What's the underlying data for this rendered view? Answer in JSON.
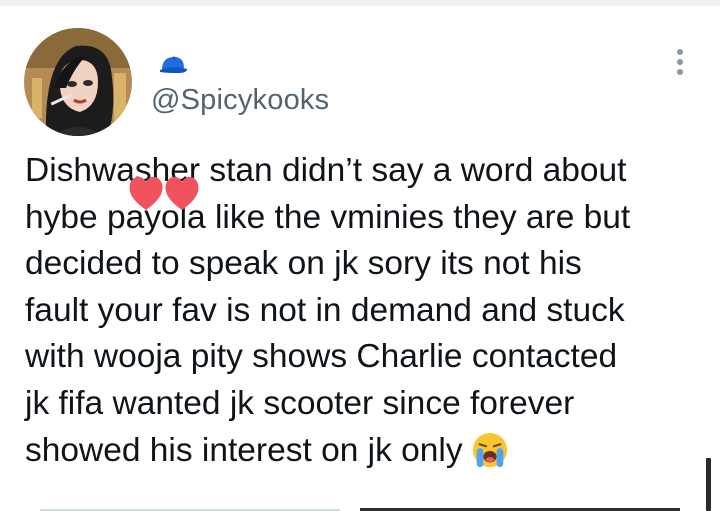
{
  "author": {
    "handle": "@Spicykooks",
    "badge_icon": "cap-icon",
    "avatar_icon": "avatar-illustration"
  },
  "menu_icon": "more-vertical-icon",
  "tweet": {
    "lines": [
      "Dishwasher stan didn’t say a word about",
      "hybe payola like the vminies they are but",
      "decided to speak on jk sory its not his",
      "fault your fav is not in demand and stuck",
      "with wooja pity shows Charlie contacted",
      "jk fifa wanted jk scooter since forever",
      "showed his interest on jk only"
    ],
    "trailing_emoji": "loudly-crying-face-icon",
    "overlay_decoration": "hearts-icon"
  },
  "colors": {
    "text": "#0f1419",
    "handle": "#536471",
    "cap": "#1d6fe0",
    "heart": "#f0525e"
  }
}
